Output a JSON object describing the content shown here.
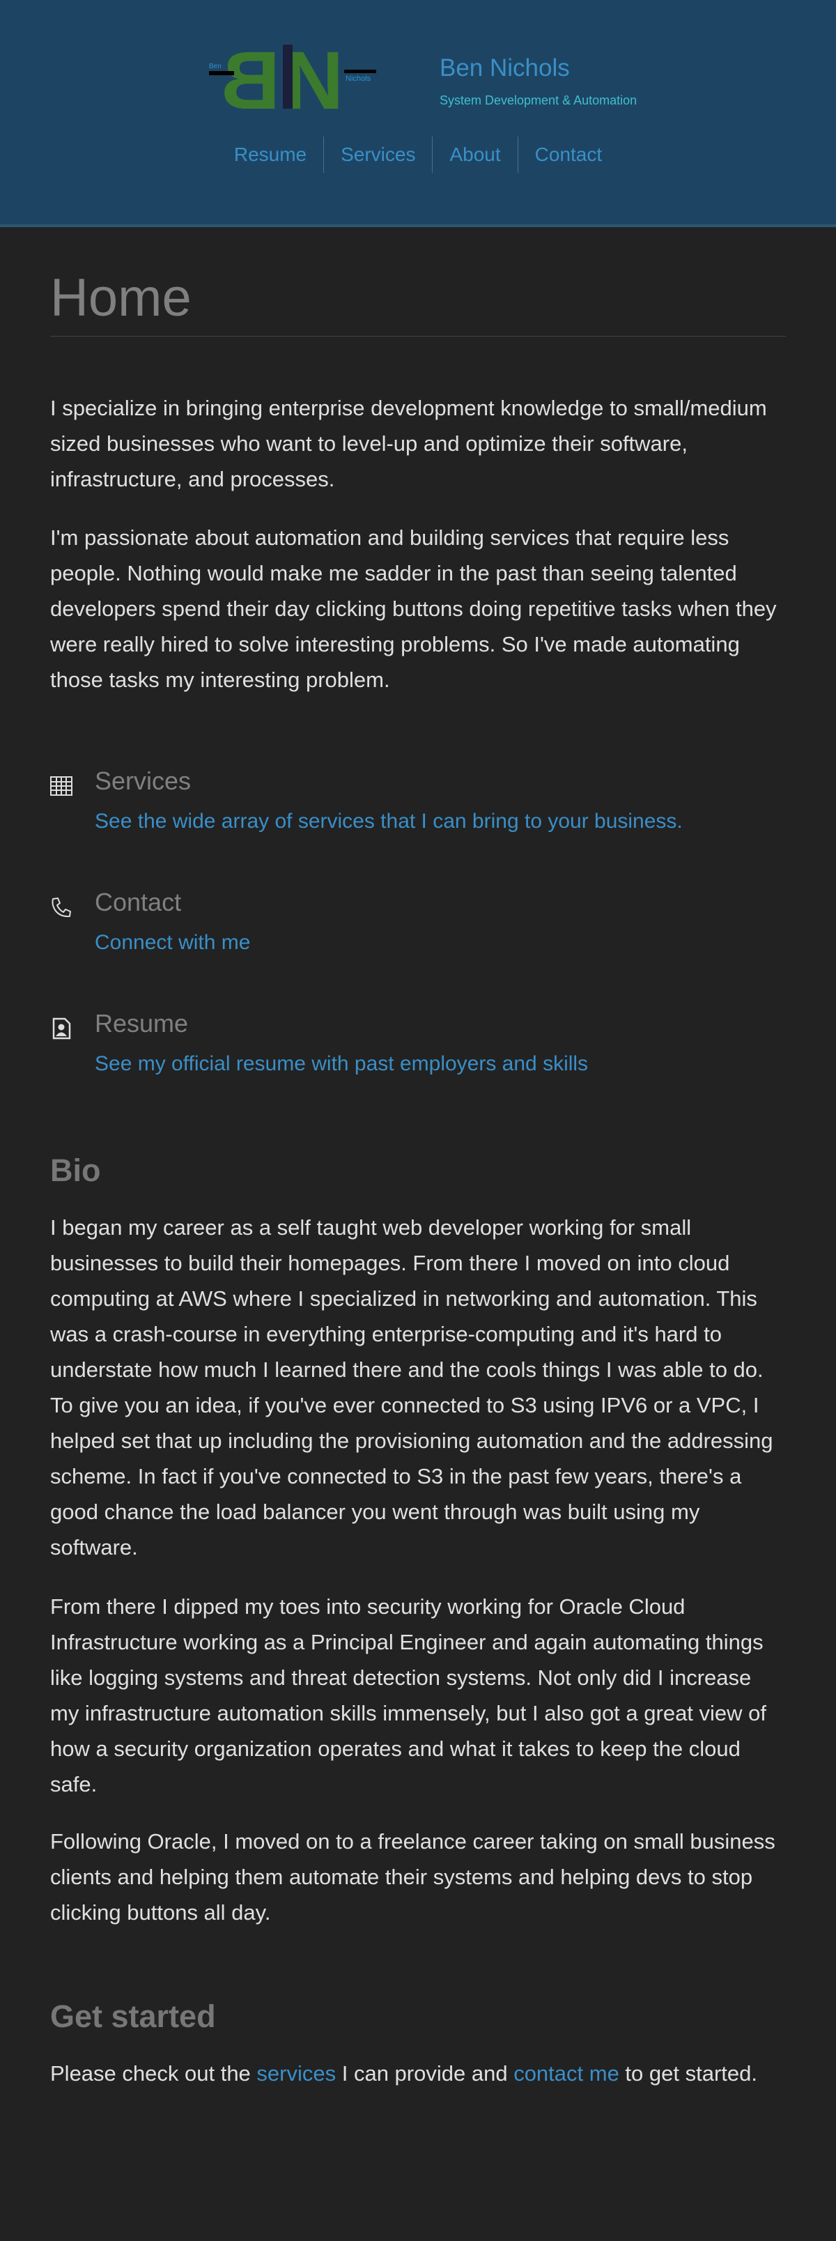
{
  "header": {
    "logo": {
      "initials": "BN",
      "first": "Ben",
      "last": "Nichols",
      "colors": {
        "letters": "#3c7a2e",
        "bar": "#1b1f3a",
        "small_text": "#2e8fd0"
      }
    },
    "name": "Ben Nichols",
    "tagline": "System Development & Automation",
    "nav": [
      "Resume",
      "Services",
      "About",
      "Contact"
    ]
  },
  "main": {
    "title": "Home",
    "intro": [
      "I specialize in bringing enterprise development knowledge to small/medium sized businesses who want to level-up and optimize their software, infrastructure, and processes.",
      "I'm passionate about automation and building services that require less people. Nothing would make me sadder in the past than seeing talented developers spend their day clicking buttons doing repetitive tasks when they were really hired to solve interesting problems. So I've made automating those tasks my interesting problem."
    ],
    "links": [
      {
        "icon": "building-icon",
        "title": "Services",
        "link": "See the wide array of services that I can bring to your business."
      },
      {
        "icon": "phone-icon",
        "title": "Contact",
        "link": "Connect with me"
      },
      {
        "icon": "resume-icon",
        "title": "Resume",
        "link": "See my official resume with past employers and skills"
      }
    ],
    "bio": {
      "title": "Bio",
      "paragraphs": [
        "I began my career as a self taught web developer working for small businesses to build their homepages. From there I moved on into cloud computing at AWS where I specialized in networking and automation. This was a crash-course in everything enterprise-computing and it's hard to understate how much I learned there and the cools things I was able to do. To give you an idea, if you've ever connected to S3 using IPV6 or a VPC, I helped set that up including the provisioning automation and the addressing scheme. In fact if you've connected to S3 in the past few years, there's a good chance the load balancer you went through was built using my software.",
        "From there I dipped my toes into security working for Oracle Cloud Infrastructure working as a Principal Engineer and again automating things like logging systems and threat detection systems. Not only did I increase my infrastructure automation skills immensely, but I also got a great view of how a security organization operates and what it takes to keep the cloud safe.",
        "Following Oracle, I moved on to a freelance career taking on small business clients and helping them automate their systems and helping devs to stop clicking buttons all day."
      ]
    },
    "get_started": {
      "title": "Get started",
      "text_before": "Please check out the ",
      "services_link": "services",
      "text_middle": " I can provide and ",
      "contact_link": "contact me",
      "text_after": " to get started."
    }
  },
  "colors": {
    "header_bg": "#1d4563",
    "page_bg": "#222222",
    "link": "#3a8fc8",
    "heading": "#808080",
    "text": "#e0e0e0"
  }
}
